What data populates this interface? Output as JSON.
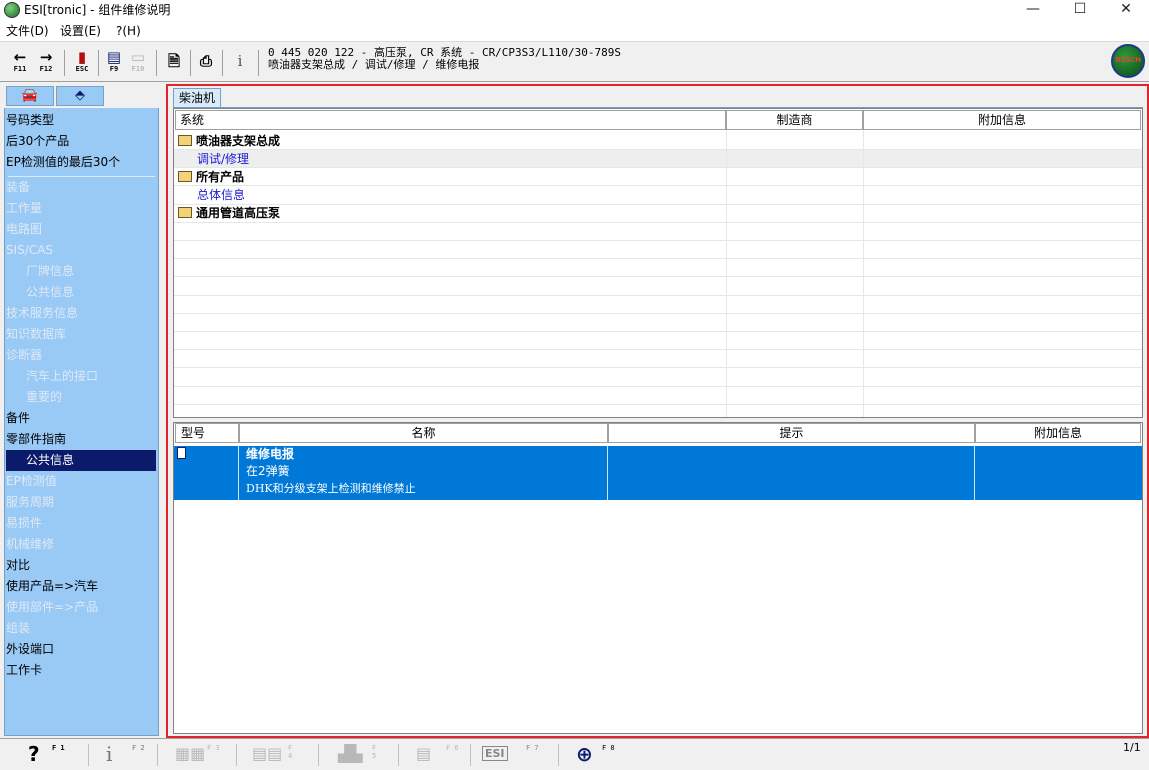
{
  "window": {
    "title": "ESI[tronic] - 组件维修说明",
    "minimize": "—",
    "maximize": "☐",
    "close": "✕"
  },
  "menu": [
    "文件(D)",
    "设置(E)",
    "?(H)"
  ],
  "toolbar": {
    "back": {
      "glyph": "←",
      "key": "F11"
    },
    "forward": {
      "glyph": "→",
      "key": "F12"
    },
    "esc": {
      "glyph": "▮",
      "key": "ESC"
    },
    "f9": {
      "glyph": "▤",
      "key": "F9"
    },
    "f10": {
      "glyph": "▭",
      "key": "F10"
    },
    "doc": {
      "glyph": "🗎"
    },
    "print": {
      "glyph": "⎙"
    },
    "info": {
      "glyph": "i"
    },
    "breadcrumb_line1": "0 445 020 122 - 高压泵, CR 系统 - CR/CP3S3/L110/30-789S",
    "breadcrumb_line2": "喷油器支架总成 / 调试/修理 / 维修电报",
    "logo_text": "BOSCH"
  },
  "sidebar": {
    "tab_car": "🚘",
    "tab_part": "⬘",
    "items": [
      {
        "label": "号码类型",
        "state": "on"
      },
      {
        "label": "后30个产品",
        "state": "on"
      },
      {
        "label": "EP检测值的最后30个",
        "state": "on"
      },
      {
        "label": "装备",
        "state": "off"
      },
      {
        "label": "工作量",
        "state": "off"
      },
      {
        "label": "电路图",
        "state": "off"
      },
      {
        "label": "SIS/CAS",
        "state": "off"
      },
      {
        "label": "厂牌信息",
        "state": "off",
        "indent": true
      },
      {
        "label": "公共信息",
        "state": "off",
        "indent": true
      },
      {
        "label": "技术服务信息",
        "state": "off"
      },
      {
        "label": "知识数据库",
        "state": "off"
      },
      {
        "label": "诊断器",
        "state": "off"
      },
      {
        "label": "汽车上的接口",
        "state": "off",
        "indent": true
      },
      {
        "label": "重要的",
        "state": "off",
        "indent": true
      },
      {
        "label": "备件",
        "state": "on"
      },
      {
        "label": "零部件指南",
        "state": "on"
      },
      {
        "label": "公共信息",
        "state": "sel",
        "indent": true
      },
      {
        "label": "EP检测值",
        "state": "off"
      },
      {
        "label": "服务周期",
        "state": "off"
      },
      {
        "label": "易损件",
        "state": "off"
      },
      {
        "label": "机械维修",
        "state": "off"
      },
      {
        "label": "对比",
        "state": "on"
      },
      {
        "label": "使用产品=>汽车",
        "state": "on"
      },
      {
        "label": "使用部件=>产品",
        "state": "off"
      },
      {
        "label": "组装",
        "state": "off"
      },
      {
        "label": "外设端口",
        "state": "on"
      },
      {
        "label": "工作卡",
        "state": "on"
      }
    ]
  },
  "main": {
    "tab_label": "柴油机",
    "upper_headers": {
      "system": "系统",
      "manufacturer": "制造商",
      "extra": "附加信息"
    },
    "tree": [
      {
        "label": "喷油器支架总成",
        "type": "folder"
      },
      {
        "label": "调试/修理",
        "type": "link"
      },
      {
        "label": "所有产品",
        "type": "folder"
      },
      {
        "label": "总体信息",
        "type": "link"
      },
      {
        "label": "通用管道高压泵",
        "type": "folder"
      }
    ],
    "lower_headers": {
      "model": "型号",
      "name": "名称",
      "hint": "提示",
      "extra": "附加信息"
    },
    "selected_row": {
      "title": "维修电报",
      "line2": "在2弹簧",
      "line3": "DHK和分级支架上检测和维修禁止"
    }
  },
  "statusbar": {
    "help": {
      "glyph": "?",
      "key": "F 1"
    },
    "info": {
      "glyph": "i",
      "key": "F 2"
    },
    "f3": {
      "glyph": "▦▦",
      "key": "F 3"
    },
    "f4": {
      "glyph": "▤▤",
      "key": "F 4"
    },
    "f5": {
      "glyph": "▟▙",
      "key": "F 5"
    },
    "f6": {
      "glyph": "▤",
      "key": "F 6"
    },
    "f7": {
      "glyph": "ESI",
      "key": "F 7"
    },
    "f8": {
      "glyph": "⊕",
      "key": "F 8"
    },
    "page": "1/1"
  }
}
